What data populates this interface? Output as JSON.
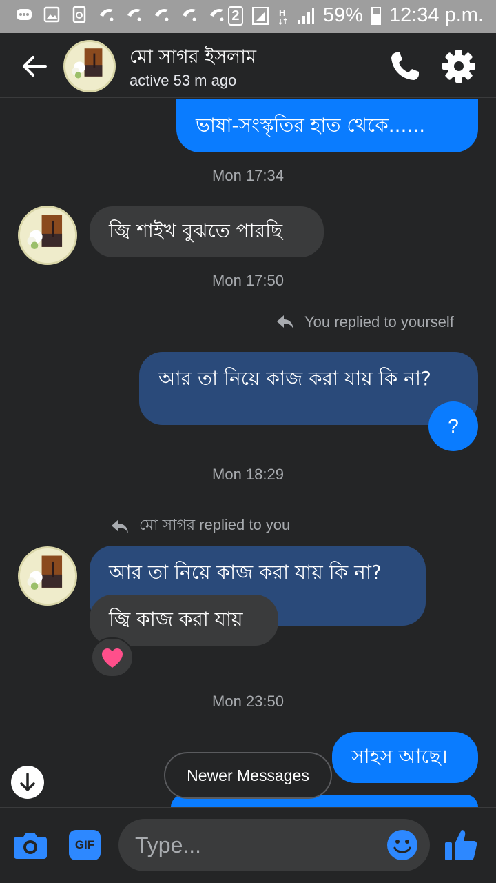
{
  "status_bar": {
    "left_icons": [
      "messenger-notification-icon",
      "image-notification-icon",
      "recycle-notification-icon",
      "carrier-icon",
      "carrier-icon",
      "carrier-icon",
      "carrier-icon",
      "carrier-icon"
    ],
    "sim_badge": "2",
    "battery_percent": "59%",
    "time": "12:34 p.m."
  },
  "header": {
    "name": "মো সাগর ইসলাম",
    "status": "active 53 m ago"
  },
  "messages": {
    "m1": {
      "text": "ভাষা-সংস্কৃতির হাত থেকে......"
    },
    "t1": "Mon 17:34",
    "m2": {
      "text": "জ্বি শাইখ বুঝতে পারছি"
    },
    "t2": "Mon 17:50",
    "reply_note_self": "You replied to yourself",
    "m3": {
      "text": "আর তা নিয়ে কাজ করা যায় কি না?"
    },
    "m4": {
      "text": "?"
    },
    "t3": "Mon 18:29",
    "reply_note_other": "মো সাগর replied to you",
    "m5_quoted": {
      "text": "আর তা নিয়ে কাজ করা যায় কি না?"
    },
    "m5": {
      "text": "জ্বি কাজ করা যায়"
    },
    "m5_reaction": "heart",
    "t4": "Mon 23:50",
    "m6": {
      "text": "সাহস আছে।"
    }
  },
  "newer_messages_label": "Newer Messages",
  "composer": {
    "placeholder": "Type...",
    "gif_label": "GIF"
  },
  "colors": {
    "background": "#242526",
    "outgoing_bubble": "#0a7cff",
    "replied_bubble": "#2a4a7a",
    "incoming_bubble": "#3a3b3c",
    "accent": "#2d88ff"
  }
}
